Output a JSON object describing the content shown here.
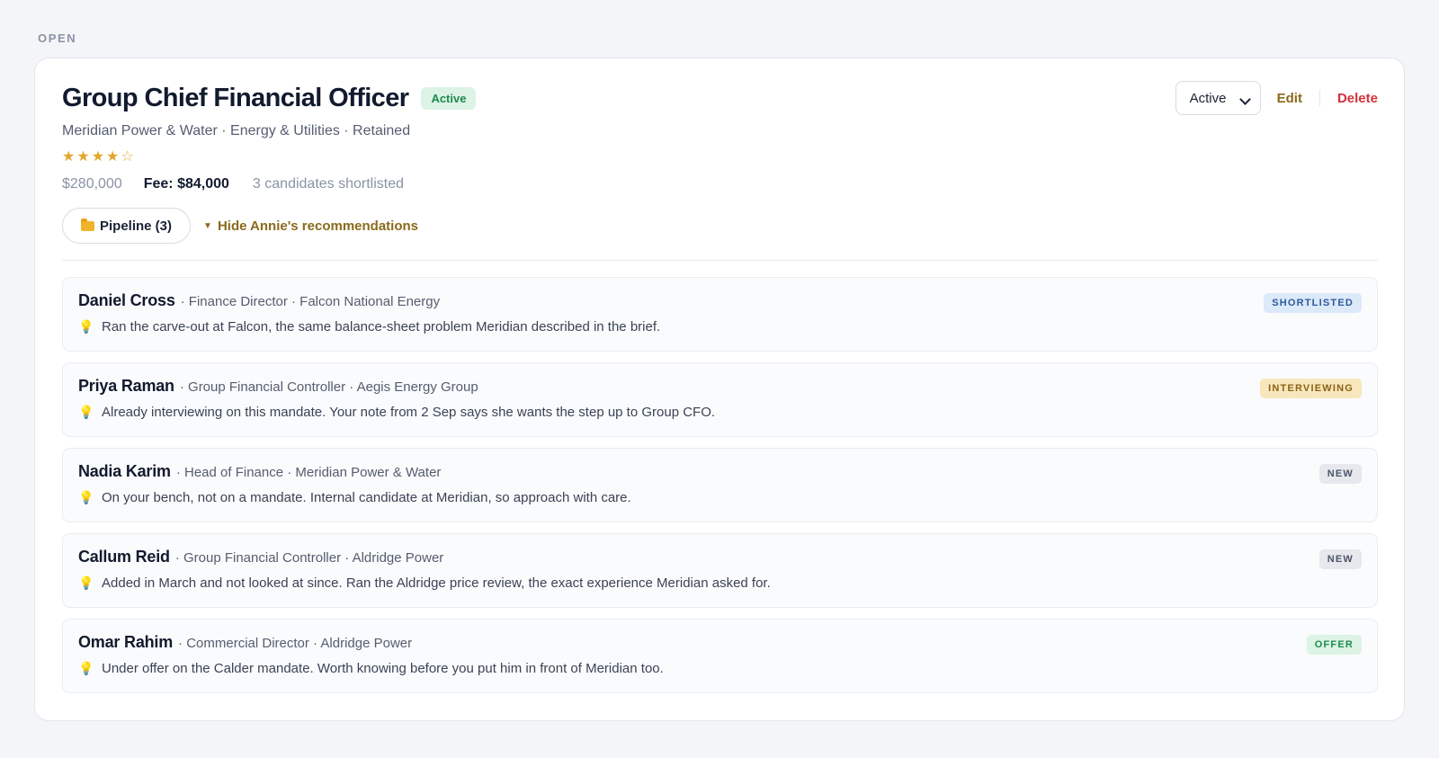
{
  "section_label": "OPEN",
  "job": {
    "title": "Group Chief Financial Officer",
    "status_pill": "Active",
    "meta": "Meridian Power & Water · Energy & Utilities · Retained",
    "rating": 4,
    "stars_text": "★★★★☆",
    "salary": "$280,000",
    "fee": "Fee: $84,000",
    "shortlisted_text": "3 candidates shortlisted"
  },
  "actions": {
    "status_select_value": "Active",
    "edit_label": "Edit",
    "delete_label": "Delete"
  },
  "controls": {
    "pipeline_label": "Pipeline (3)",
    "recommendations_toggle_label": "Hide Annie's recommendations",
    "toggle_glyph": "▼"
  },
  "recommendations": [
    {
      "name": "Daniel Cross",
      "role": "· Finance Director · Falcon National Energy",
      "note": "Ran the carve-out at Falcon, the same balance-sheet problem Meridian described in the brief.",
      "badge": "SHORTLISTED"
    },
    {
      "name": "Priya Raman",
      "role": "· Group Financial Controller · Aegis Energy Group",
      "note": "Already interviewing on this mandate. Your note from 2 Sep says she wants the step up to Group CFO.",
      "badge": "INTERVIEWING"
    },
    {
      "name": "Nadia Karim",
      "role": "· Head of Finance · Meridian Power & Water",
      "note": "On your bench, not on a mandate. Internal candidate at Meridian, so approach with care.",
      "badge": "NEW"
    },
    {
      "name": "Callum Reid",
      "role": "· Group Financial Controller · Aldridge Power",
      "note": "Added in March and not looked at since. Ran the Aldridge price review, the exact experience Meridian asked for.",
      "badge": "NEW"
    },
    {
      "name": "Omar Rahim",
      "role": "· Commercial Director · Aldridge Power",
      "note": "Under offer on the Calder mandate. Worth knowing before you put him in front of Meridian too.",
      "badge": "OFFER"
    }
  ],
  "colors": {
    "accent": "#8a6a1b",
    "danger": "#d2323a",
    "active_green": "#1f8a4c",
    "star": "#e3a72b"
  },
  "icons": {
    "pipeline": "folder-icon",
    "toggle": "triangle-down-icon",
    "note": "lightbulb-icon",
    "select": "chevron-down-icon"
  }
}
